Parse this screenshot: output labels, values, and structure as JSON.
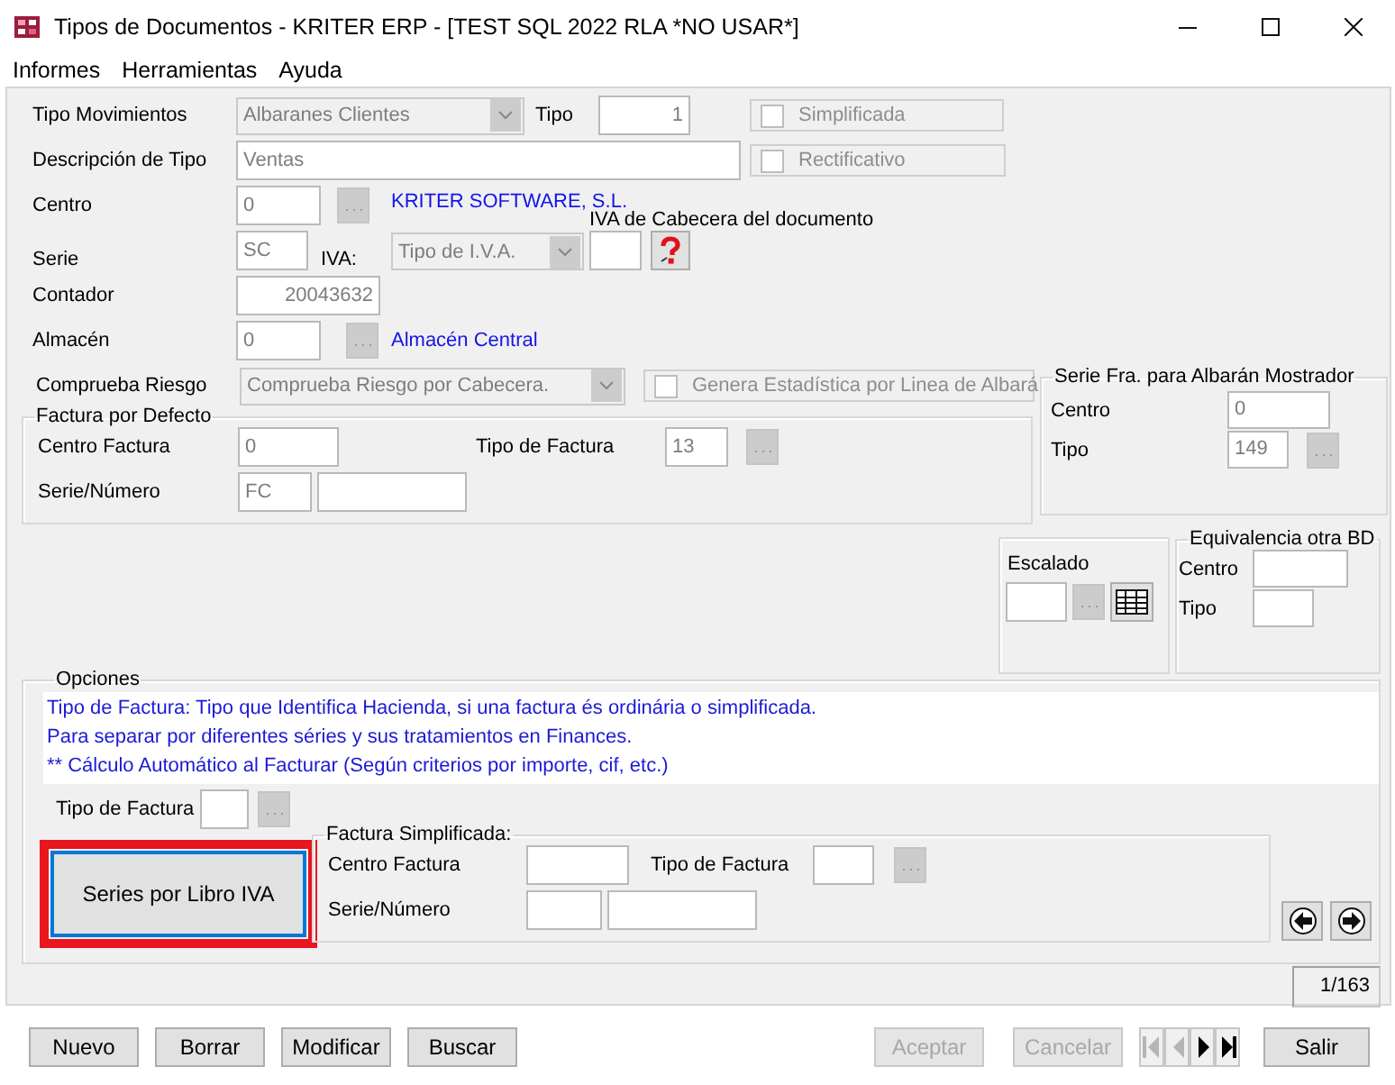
{
  "window": {
    "title": "Tipos de Documentos - KRITER ERP - [TEST SQL 2022 RLA *NO USAR*]"
  },
  "menu": [
    "Informes",
    "Herramientas",
    "Ayuda"
  ],
  "header": {
    "tipo_movimientos": {
      "label": "Tipo Movimientos",
      "value": "Albaranes Clientes",
      "disabled": true
    },
    "tipo": {
      "label": "Tipo",
      "value": "1"
    },
    "simplificada": {
      "label": "Simplificada",
      "checked": false,
      "disabled": true
    },
    "descripcion": {
      "label": "Descripción de Tipo",
      "value": "Ventas"
    },
    "rectificativo": {
      "label": "Rectificativo",
      "checked": false,
      "disabled": true
    },
    "centro": {
      "label": "Centro",
      "value": "0",
      "link": "KRITER SOFTWARE, S.L."
    },
    "serie": {
      "label": "Serie",
      "value": "SC"
    },
    "iva": {
      "label": "IVA:",
      "value": "Tipo de I.V.A.",
      "disabled": true
    },
    "iva_cabecera": {
      "label": "IVA de Cabecera del documento"
    },
    "contador": {
      "label": "Contador",
      "value": "20043632"
    },
    "almacen": {
      "label": "Almacén",
      "value": "0",
      "link": "Almacén Central"
    },
    "comprueba_riesgo": {
      "label": "Comprueba Riesgo",
      "value": "Comprueba Riesgo por Cabecera.",
      "disabled": true
    },
    "genera_estadistica": {
      "label": "Genera Estadística por Linea de Albará",
      "checked": false,
      "disabled": true
    }
  },
  "factura_por_defecto": {
    "title": "Factura por Defecto",
    "centro_label": "Centro Factura",
    "centro_value": "0",
    "tipo_label": "Tipo de Factura",
    "tipo_value": "13",
    "serie_label": "Serie/Número",
    "serie_value": "FC"
  },
  "serie_mostrador": {
    "title": "Serie Fra. para Albarán Mostrador",
    "centro_label": "Centro",
    "centro_value": "0",
    "tipo_label": "Tipo",
    "tipo_value": "149"
  },
  "escalado": {
    "label": "Escalado"
  },
  "equivalencia": {
    "title": "Equivalencia otra BD",
    "centro_label": "Centro",
    "tipo_label": "Tipo"
  },
  "opciones": {
    "title": "Opciones",
    "notes": [
      "Tipo de Factura: Tipo que Identifica Hacienda, si una factura és ordinária o simplificada.",
      "Para separar por diferentes séries y sus tratamientos en Finances.",
      "** Cálculo Automático al Facturar (Según criterios por importe, cif, etc.)"
    ],
    "tipo_label": "Tipo de Factura",
    "series_button": {
      "label": "Series por Libro IVA",
      "highlighted": true
    },
    "simplificada": {
      "title": "Factura Simplificada:",
      "centro_label": "Centro Factura",
      "tipo_label": "Tipo de Factura",
      "serie_label": "Serie/Número"
    }
  },
  "record_counter": "1/163",
  "actions_left": [
    {
      "label": "Nuevo",
      "disabled": false
    },
    {
      "label": "Borrar",
      "disabled": false
    },
    {
      "label": "Modificar",
      "disabled": false
    },
    {
      "label": "Buscar",
      "disabled": false
    }
  ],
  "actions_right": [
    {
      "label": "Aceptar",
      "disabled": true
    },
    {
      "label": "Cancelar",
      "disabled": true
    }
  ],
  "navigation": [
    {
      "kind": "first",
      "disabled": true
    },
    {
      "kind": "prev",
      "disabled": true
    },
    {
      "kind": "next",
      "disabled": false
    },
    {
      "kind": "last",
      "disabled": false
    }
  ],
  "exit_button": {
    "label": "Salir"
  }
}
